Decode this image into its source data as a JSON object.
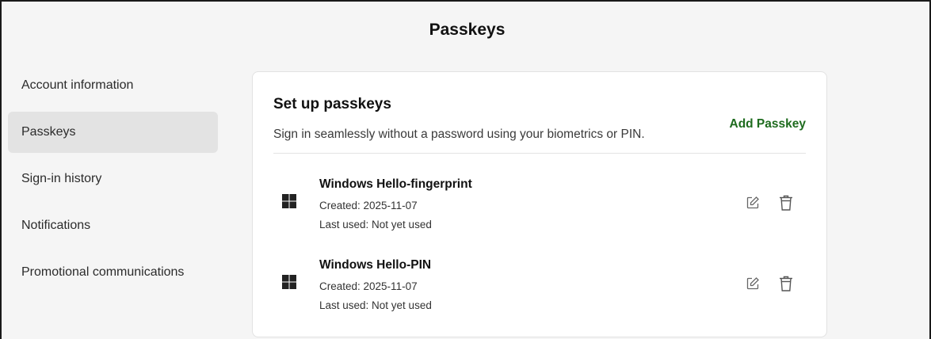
{
  "page": {
    "title": "Passkeys"
  },
  "sidebar": {
    "items": [
      {
        "label": "Account information"
      },
      {
        "label": "Passkeys",
        "active": true
      },
      {
        "label": "Sign-in history"
      },
      {
        "label": "Notifications"
      },
      {
        "label": "Promotional communications"
      }
    ]
  },
  "card": {
    "title": "Set up passkeys",
    "subtitle": "Sign in seamlessly without a password using your biometrics or PIN.",
    "add_label": "Add Passkey",
    "add_color": "#1e6b1e",
    "passkeys": [
      {
        "name": "Windows Hello-fingerprint",
        "created": "Created: 2025-11-07",
        "last_used": "Last used: Not yet used",
        "icon": "windows-icon"
      },
      {
        "name": "Windows Hello-PIN",
        "created": "Created: 2025-11-07",
        "last_used": "Last used: Not yet used",
        "icon": "windows-icon"
      }
    ],
    "action_icons": [
      "edit-icon",
      "trash-icon"
    ]
  }
}
